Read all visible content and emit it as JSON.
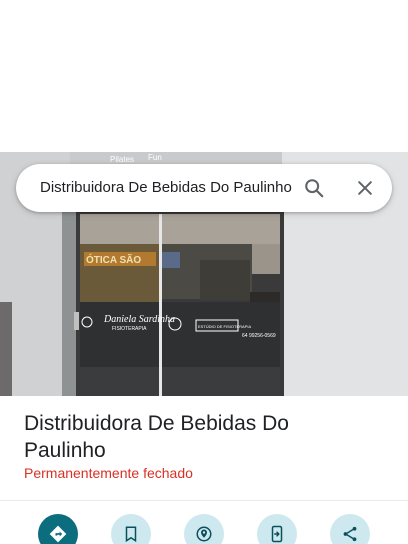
{
  "search": {
    "query": "Distribuidora De Bebidas Do Paulinho",
    "search_icon": "search-icon",
    "clear_icon": "close-icon"
  },
  "photo": {
    "wall_signs": [
      "Pilates",
      "Fun"
    ],
    "door_logo_left": "Daniela Sardinha",
    "door_subtitle_left": "FISIOTERAPIA",
    "door_sign_right": "ESTÚDIO DE FISIOTERAPIA",
    "door_phone_right": "64 99256-0569",
    "reflection_text": "ÓTICA SÃO"
  },
  "place": {
    "name": "Distribuidora De Bebidas Do Paulinho",
    "status": "Permanentemente fechado",
    "status_color": "#d93025"
  },
  "actions": [
    {
      "name": "directions",
      "icon": "directions-icon",
      "primary": true
    },
    {
      "name": "save",
      "icon": "bookmark-icon",
      "primary": false
    },
    {
      "name": "nearby",
      "icon": "nearby-icon",
      "primary": false
    },
    {
      "name": "send-to-phone",
      "icon": "send-to-phone-icon",
      "primary": false
    },
    {
      "name": "share",
      "icon": "share-icon",
      "primary": false
    }
  ],
  "colors": {
    "accent": "#0b6d7d",
    "accent_light": "#cde9ef",
    "text": "#202124"
  }
}
